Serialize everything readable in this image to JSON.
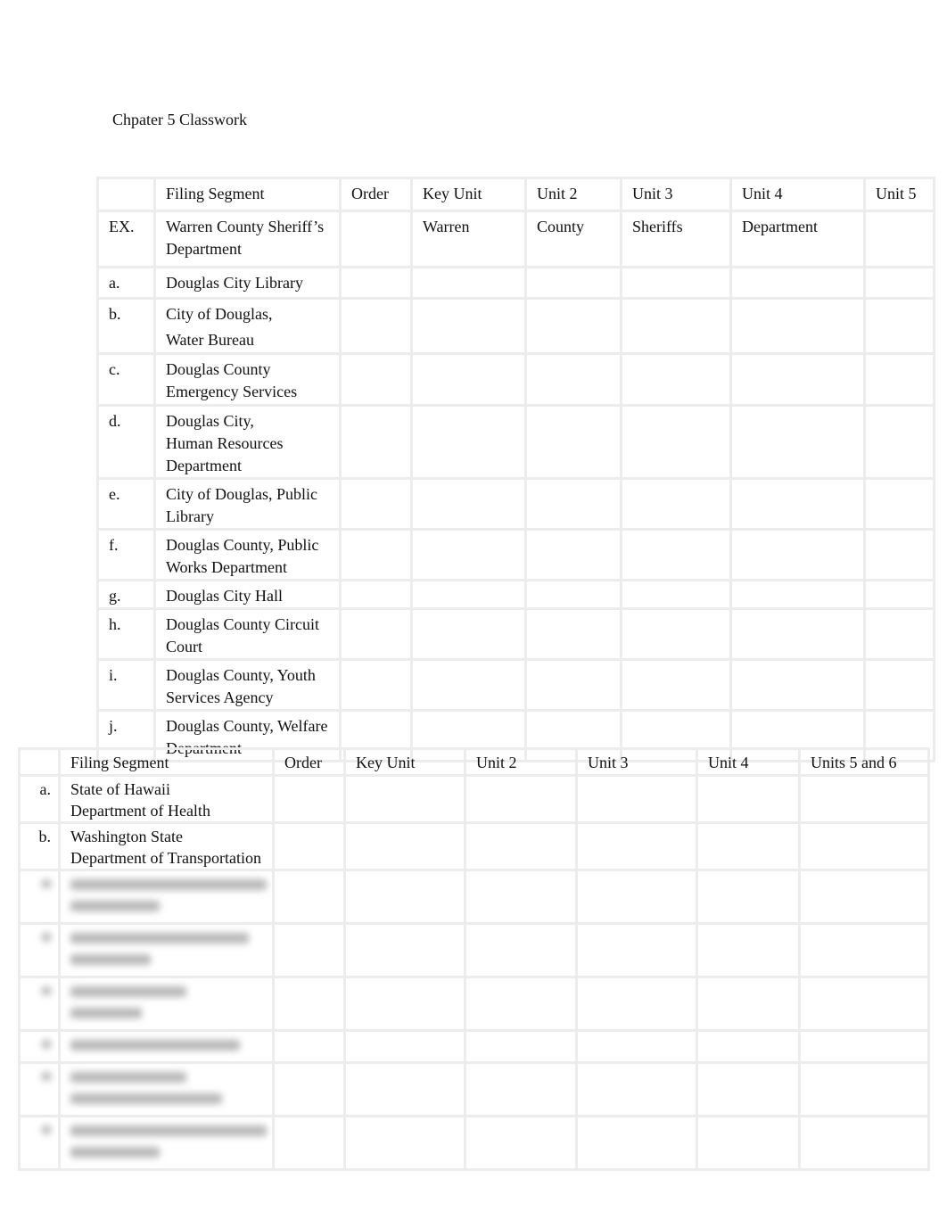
{
  "title": "Chpater 5 Classwork",
  "table1": {
    "headers": [
      "",
      "Filing Segment",
      "Order",
      "Key Unit",
      "Unit 2",
      "Unit 3",
      "Unit 4",
      "Unit 5"
    ],
    "rows": [
      {
        "label": "EX.",
        "segment": [
          "Warren County Sheriff’s",
          "Department"
        ],
        "order": "",
        "key": "Warren",
        "u2": "County",
        "u3": "Sheriffs",
        "u4": "Department",
        "u5": ""
      },
      {
        "label": "a.",
        "segment": [
          "Douglas City Library"
        ]
      },
      {
        "label": "b.",
        "segment": [
          "City of Douglas,",
          "Water Bureau"
        ]
      },
      {
        "label": "c.",
        "segment": [
          "Douglas County",
          "Emergency Services"
        ]
      },
      {
        "label": "d.",
        "segment": [
          "Douglas City,",
          "Human Resources",
          "Department"
        ]
      },
      {
        "label": "e.",
        "segment": [
          "City of Douglas, Public",
          "Library"
        ]
      },
      {
        "label": "f.",
        "segment": [
          "Douglas County, Public",
          "Works Department"
        ]
      },
      {
        "label": "g.",
        "segment": [
          "Douglas City Hall"
        ]
      },
      {
        "label": "h.",
        "segment": [
          "Douglas County Circuit",
          "Court"
        ]
      },
      {
        "label": "i.",
        "segment": [
          "Douglas County, Youth",
          "Services Agency"
        ]
      },
      {
        "label": "j.",
        "segment": [
          "Douglas County, Welfare",
          "Department"
        ]
      }
    ]
  },
  "table2": {
    "headers": [
      "",
      "Filing Segment",
      "Order",
      "Key Unit",
      "Unit 2",
      "Unit 3",
      "Unit 4",
      "Units 5 and 6"
    ],
    "rows": [
      {
        "label": "a.",
        "segment": [
          "State of Hawaii",
          "Department of Health"
        ]
      },
      {
        "label": "b.",
        "segment": [
          "Washington State",
          "Department of Transportation"
        ]
      }
    ],
    "blurred_rows": 6
  }
}
